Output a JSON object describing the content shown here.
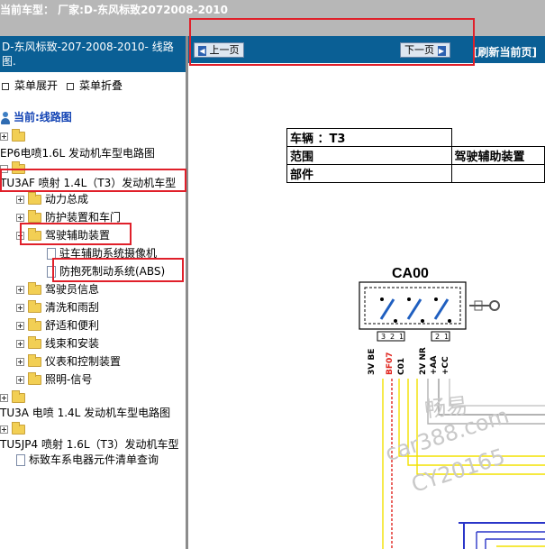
{
  "window": {
    "title": "当前车型：  厂家:D-东风标致2072008-2010"
  },
  "left_panel": {
    "header": "D-东风标致-207-2008-2010- 线路图.",
    "expand_menu": "菜单展开",
    "collapse_menu": "菜单折叠",
    "current_label": "当前:线路图",
    "tree": [
      {
        "label": "EP6电喷1.6L 发动机车型电路图"
      },
      {
        "label": ""
      },
      {
        "label": "TU3AF 喷射 1.4L（T3）发动机车型"
      },
      {
        "label": "动力总成"
      },
      {
        "label": "防护装置和车门"
      },
      {
        "label": "驾驶辅助装置"
      },
      {
        "label": "驻车辅助系统摄像机"
      },
      {
        "label": "防抱死制动系统(ABS)"
      },
      {
        "label": "驾驶员信息"
      },
      {
        "label": "清洗和雨刮"
      },
      {
        "label": "舒适和便利"
      },
      {
        "label": "线束和安装"
      },
      {
        "label": "仪表和控制装置"
      },
      {
        "label": "照明-信号"
      },
      {
        "label": "TU3A 电喷 1.4L 发动机车型电路图"
      },
      {
        "label": "TU5JP4 喷射 1.6L（T3）发动机车型"
      },
      {
        "label": "标致车系电器元件清单查询"
      }
    ]
  },
  "navigation": {
    "prev_label": "上一页",
    "next_label": "下一页",
    "refresh_label": "[刷新当前页]"
  },
  "document": {
    "vehicle_label": "车辆 ：T3",
    "scope_label": "范围",
    "scope_value": "驾驶辅助装置",
    "part_label": "部件",
    "component_code": "CA00",
    "pins": [
      "3",
      "2",
      "1",
      "2",
      "1"
    ],
    "wire_labels": [
      "3V BE",
      "BF07",
      "C01",
      "2V NR",
      "+AA",
      "+CC"
    ]
  },
  "watermark": {
    "line1": "畅易",
    "line2": "car388.com",
    "line3": "CY20165"
  },
  "colors": {
    "header_blue": "#0a5f95",
    "highlight_red": "#e0202a",
    "wire_yellow": "#f3e200",
    "wire_blue": "#2a35c8",
    "wire_red": "#e0241e"
  }
}
